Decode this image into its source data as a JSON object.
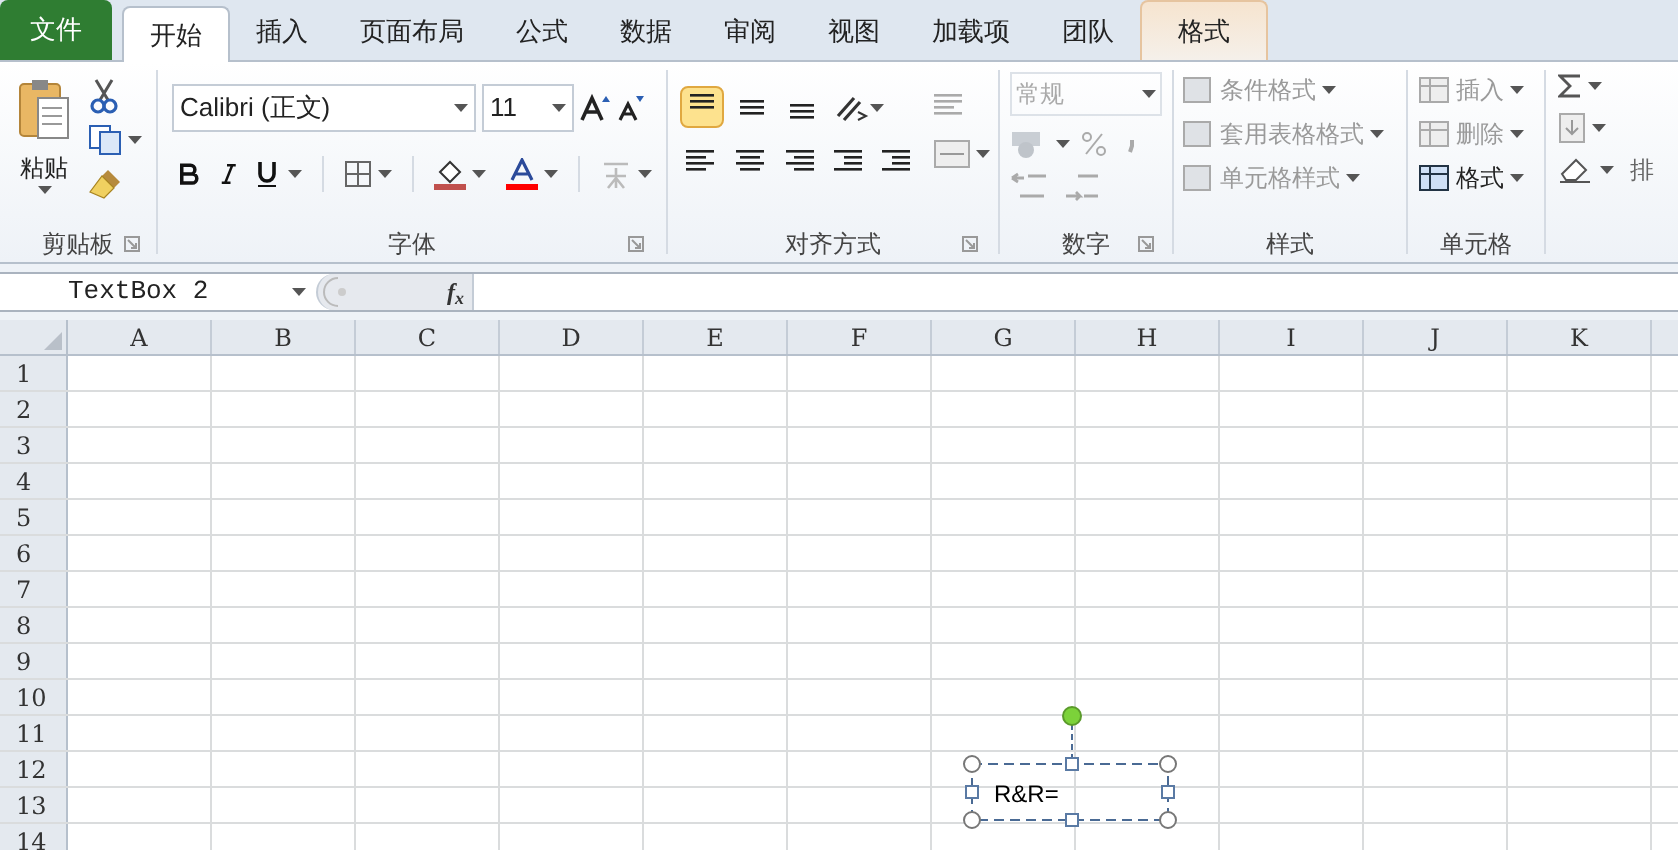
{
  "file_tab": "文件",
  "tabs": [
    {
      "label": "开始",
      "selected": true,
      "kind": "normal"
    },
    {
      "label": "插入",
      "selected": false,
      "kind": "normal"
    },
    {
      "label": "页面布局",
      "selected": false,
      "kind": "normal"
    },
    {
      "label": "公式",
      "selected": false,
      "kind": "normal"
    },
    {
      "label": "数据",
      "selected": false,
      "kind": "normal"
    },
    {
      "label": "审阅",
      "selected": false,
      "kind": "normal"
    },
    {
      "label": "视图",
      "selected": false,
      "kind": "normal"
    },
    {
      "label": "加载项",
      "selected": false,
      "kind": "normal"
    },
    {
      "label": "团队",
      "selected": false,
      "kind": "normal"
    },
    {
      "label": "格式",
      "selected": false,
      "kind": "contextual"
    }
  ],
  "clipboard": {
    "paste": "粘贴",
    "label": "剪贴板"
  },
  "font": {
    "name": "Calibri (正文)",
    "size": "11",
    "label": "字体",
    "phonetic_disabled": true
  },
  "alignment": {
    "label": "对齐方式",
    "vertical": [
      {
        "selected": true
      },
      {
        "selected": false
      },
      {
        "selected": false
      }
    ],
    "wrap_disabled": true
  },
  "number": {
    "format": "常规",
    "label": "数字",
    "disabled": true
  },
  "styles": {
    "label": "样式",
    "items": [
      {
        "label": "条件格式",
        "disabled": true
      },
      {
        "label": "套用表格格式",
        "disabled": true
      },
      {
        "label": "单元格样式",
        "disabled": true
      }
    ]
  },
  "cells": {
    "label": "单元格",
    "items": [
      {
        "label": "插入",
        "disabled": true
      },
      {
        "label": "删除",
        "disabled": true
      },
      {
        "label": "格式",
        "disabled": false
      }
    ]
  },
  "editing": {
    "sort_label": "排"
  },
  "formula_bar": {
    "name_box": "TextBox 2",
    "fx": "f$_{x}$"
  },
  "columns": [
    "A",
    "B",
    "C",
    "D",
    "E",
    "F",
    "G",
    "H",
    "I",
    "J",
    "K"
  ],
  "rows": [
    "1",
    "2",
    "3",
    "4",
    "5",
    "6",
    "7",
    "8",
    "9",
    "10",
    "11",
    "12",
    "13",
    "14"
  ],
  "text_box": {
    "text": "R&R="
  }
}
